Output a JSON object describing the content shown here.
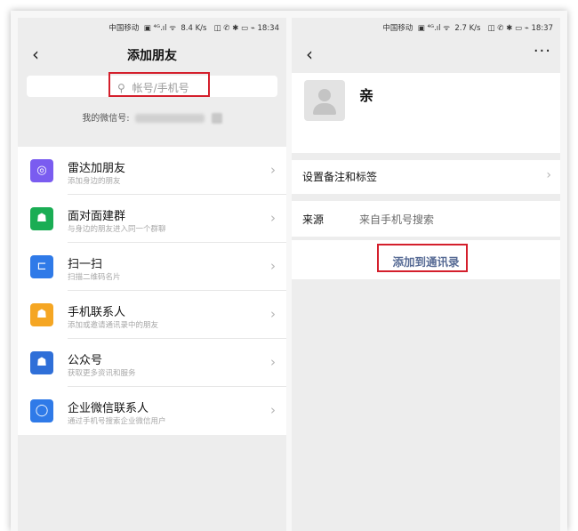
{
  "colors": {
    "highlight_box": "#d41f2c",
    "link_blue": "#576b95",
    "radar_icon": "#7a5cf0",
    "group_icon": "#1aad54",
    "scan_icon": "#2f7ae8",
    "contacts_icon": "#f5a623",
    "official_icon": "#2f6fd8",
    "wecom_icon": "#2f7ae8"
  },
  "left": {
    "status": {
      "carrier": "中国移动",
      "speed": "8.4 K/s",
      "time": "18:34"
    },
    "title": "添加朋友",
    "search_placeholder": "帐号/手机号",
    "my_wechat_label": "我的微信号:",
    "menu": [
      {
        "icon": "radar-icon",
        "glyph": "◎",
        "color": "#7a5cf0",
        "title": "雷达加朋友",
        "subtitle": "添加身边的朋友"
      },
      {
        "icon": "group-icon",
        "glyph": "☗",
        "color": "#1aad54",
        "title": "面对面建群",
        "subtitle": "与身边的朋友进入同一个群聊"
      },
      {
        "icon": "scan-icon",
        "glyph": "⊏",
        "color": "#2f7ae8",
        "title": "扫一扫",
        "subtitle": "扫描二维码名片"
      },
      {
        "icon": "contacts-icon",
        "glyph": "☗",
        "color": "#f5a623",
        "title": "手机联系人",
        "subtitle": "添加或邀请通讯录中的朋友"
      },
      {
        "icon": "official-icon",
        "glyph": "☗",
        "color": "#2f6fd8",
        "title": "公众号",
        "subtitle": "获取更多资讯和服务"
      },
      {
        "icon": "wecom-icon",
        "glyph": "◯",
        "color": "#2f7ae8",
        "title": "企业微信联系人",
        "subtitle": "通过手机号搜索企业微信用户"
      }
    ]
  },
  "right": {
    "status": {
      "carrier": "中国移动",
      "speed": "2.7 K/s",
      "time": "18:37"
    },
    "more": "···",
    "profile_name": "亲",
    "remark_label": "设置备注和标签",
    "source_label": "来源",
    "source_value": "来自手机号搜索",
    "add_button": "添加到通讯录"
  }
}
